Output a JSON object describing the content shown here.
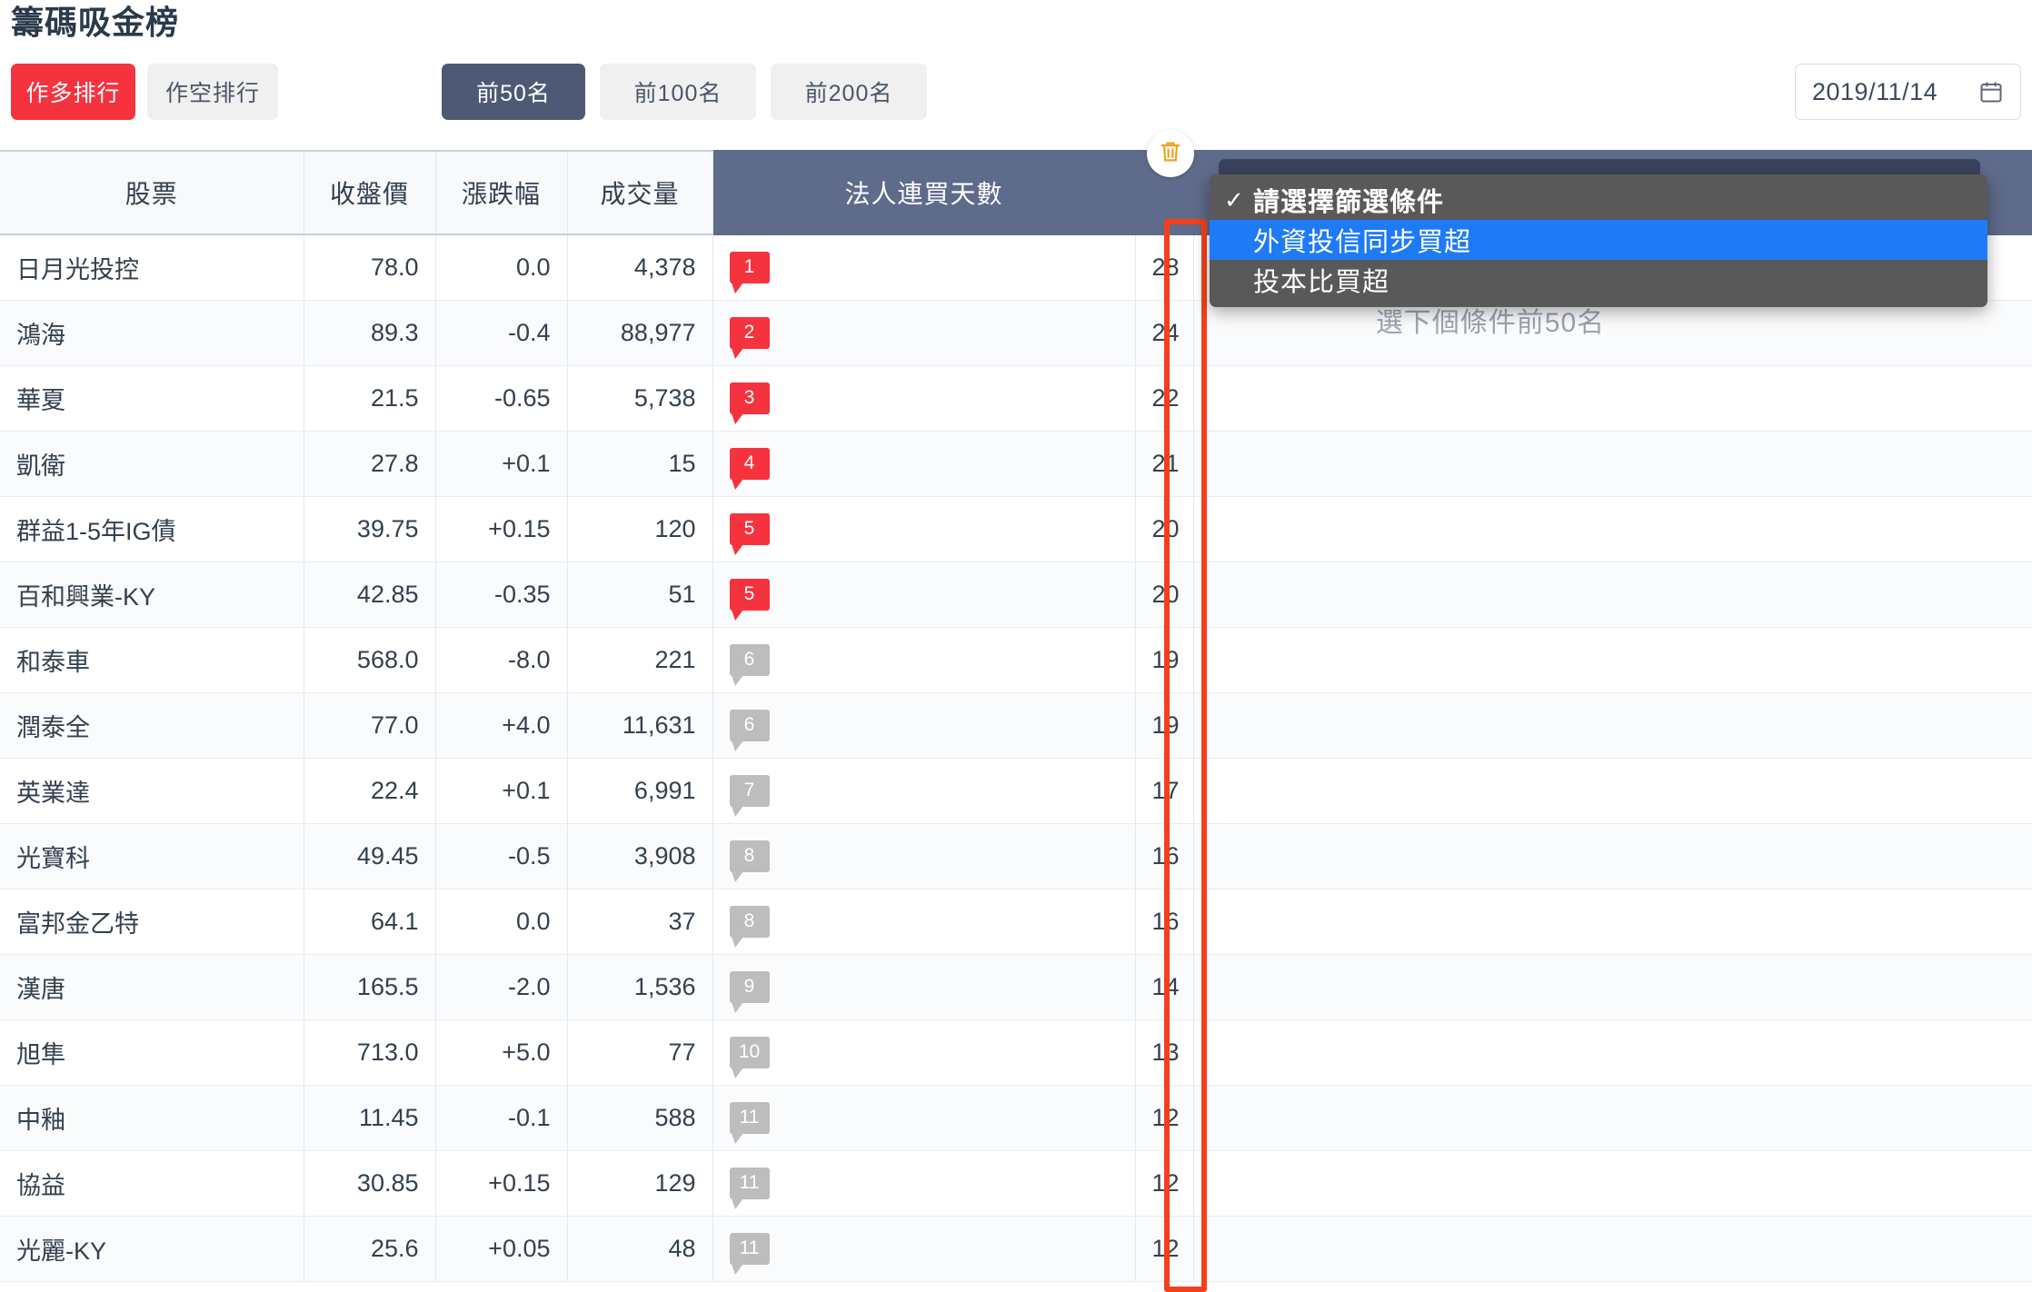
{
  "header": {
    "title": "籌碼吸金榜"
  },
  "toolbar": {
    "direction_buttons": [
      {
        "label": "作多排行",
        "active": true
      },
      {
        "label": "作空排行",
        "active": false
      }
    ],
    "count_buttons": [
      {
        "label": "前50名",
        "active": true
      },
      {
        "label": "前100名",
        "active": false
      },
      {
        "label": "前200名",
        "active": false
      }
    ],
    "date_value": "2019/11/14",
    "calendar_icon": "calendar-icon"
  },
  "table": {
    "columns": [
      "股票",
      "收盤價",
      "漲跌幅",
      "成交量",
      "法人連買天數"
    ],
    "rows": [
      {
        "name": "日月光投控",
        "price": "78.0",
        "price_dir": "flat",
        "change": "0.0",
        "change_dir": "flat",
        "volume": "4,378",
        "rank": "1",
        "rank_color": "red",
        "days": "28"
      },
      {
        "name": "鴻海",
        "price": "89.3",
        "price_dir": "down",
        "change": "-0.4",
        "change_dir": "down",
        "volume": "88,977",
        "rank": "2",
        "rank_color": "red",
        "days": "24"
      },
      {
        "name": "華夏",
        "price": "21.5",
        "price_dir": "down",
        "change": "-0.65",
        "change_dir": "down",
        "volume": "5,738",
        "rank": "3",
        "rank_color": "red",
        "days": "22"
      },
      {
        "name": "凱衛",
        "price": "27.8",
        "price_dir": "up",
        "change": "+0.1",
        "change_dir": "up",
        "volume": "15",
        "rank": "4",
        "rank_color": "red",
        "days": "21"
      },
      {
        "name": "群益1-5年IG債",
        "price": "39.75",
        "price_dir": "up",
        "change": "+0.15",
        "change_dir": "up",
        "volume": "120",
        "rank": "5",
        "rank_color": "red",
        "days": "20"
      },
      {
        "name": "百和興業-KY",
        "price": "42.85",
        "price_dir": "down",
        "change": "-0.35",
        "change_dir": "down",
        "volume": "51",
        "rank": "5",
        "rank_color": "red",
        "days": "20"
      },
      {
        "name": "和泰車",
        "price": "568.0",
        "price_dir": "down",
        "change": "-8.0",
        "change_dir": "down",
        "volume": "221",
        "rank": "6",
        "rank_color": "gray",
        "days": "19"
      },
      {
        "name": "潤泰全",
        "price": "77.0",
        "price_dir": "up",
        "change": "+4.0",
        "change_dir": "up",
        "volume": "11,631",
        "rank": "6",
        "rank_color": "gray",
        "days": "19"
      },
      {
        "name": "英業達",
        "price": "22.4",
        "price_dir": "up",
        "change": "+0.1",
        "change_dir": "up",
        "volume": "6,991",
        "rank": "7",
        "rank_color": "gray",
        "days": "17"
      },
      {
        "name": "光寶科",
        "price": "49.45",
        "price_dir": "down",
        "change": "-0.5",
        "change_dir": "down",
        "volume": "3,908",
        "rank": "8",
        "rank_color": "gray",
        "days": "16"
      },
      {
        "name": "富邦金乙特",
        "price": "64.1",
        "price_dir": "flat",
        "change": "0.0",
        "change_dir": "flat",
        "volume": "37",
        "rank": "8",
        "rank_color": "gray",
        "days": "16"
      },
      {
        "name": "漢唐",
        "price": "165.5",
        "price_dir": "down",
        "change": "-2.0",
        "change_dir": "down",
        "volume": "1,536",
        "rank": "9",
        "rank_color": "gray",
        "days": "14"
      },
      {
        "name": "旭隼",
        "price": "713.0",
        "price_dir": "up",
        "change": "+5.0",
        "change_dir": "up",
        "volume": "77",
        "rank": "10",
        "rank_color": "gray",
        "days": "13"
      },
      {
        "name": "中釉",
        "price": "11.45",
        "price_dir": "down",
        "change": "-0.1",
        "change_dir": "down",
        "volume": "588",
        "rank": "11",
        "rank_color": "gray",
        "days": "12"
      },
      {
        "name": "協益",
        "price": "30.85",
        "price_dir": "up",
        "change": "+0.15",
        "change_dir": "up",
        "volume": "129",
        "rank": "11",
        "rank_color": "gray",
        "days": "12"
      },
      {
        "name": "光麗-KY",
        "price": "25.6",
        "price_dir": "up",
        "change": "+0.05",
        "change_dir": "up",
        "volume": "48",
        "rank": "11",
        "rank_color": "gray",
        "days": "12"
      }
    ]
  },
  "filter_panel": {
    "hint": "選下個條件前50名",
    "delete_icon": "trash-icon",
    "options": [
      {
        "label": "請選擇篩選條件",
        "checked": true,
        "highlighted": false
      },
      {
        "label": "外資投信同步買超",
        "checked": false,
        "highlighted": true
      },
      {
        "label": "投本比買超",
        "checked": false,
        "highlighted": false
      }
    ],
    "check_glyph": "✓"
  },
  "colors": {
    "accent_red": "#f5333f",
    "header_dark": "#5e6b8a",
    "up": "#e8323f",
    "down": "#22c11e",
    "highlight_border": "#f4401a",
    "select_highlight": "#1f7bf5",
    "trash": "#f5a01e"
  }
}
